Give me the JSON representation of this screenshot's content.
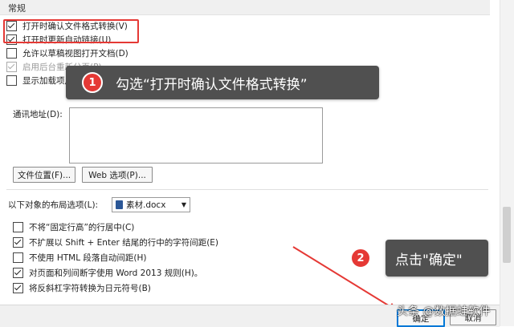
{
  "section": {
    "title": "常规"
  },
  "general_options": [
    {
      "label": "打开时确认文件格式转换(V)",
      "checked": true,
      "disabled": false
    },
    {
      "label": "打开时更新自动链接(U)",
      "checked": true,
      "disabled": false
    },
    {
      "label": "允许以草稿视图打开文档(D)",
      "checked": false,
      "disabled": false
    },
    {
      "label": "启用后台重新分页(P)",
      "checked": true,
      "disabled": true
    },
    {
      "label": "显示加载项用户界面错误(U)",
      "checked": false,
      "disabled": false
    }
  ],
  "tooltip1": {
    "number": "1",
    "text": "勾选“打开时确认文件格式转换”"
  },
  "address": {
    "label": "通讯地址(D):",
    "value": ""
  },
  "buttons": {
    "file_location": "文件位置(F)...",
    "web_options": "Web 选项(P)..."
  },
  "layout": {
    "label": "以下对象的布局选项(L):",
    "document": "素材.docx"
  },
  "layout_options": [
    {
      "label": "不将“固定行高”的行居中(C)",
      "checked": false
    },
    {
      "label": "不扩展以 Shift + Enter 结尾的行中的字符间距(E)",
      "checked": true
    },
    {
      "label": "不使用 HTML 段落自动间距(H)",
      "checked": false
    },
    {
      "label": "对页面和列间断字使用 Word 2013 规则(H)。",
      "checked": true
    },
    {
      "label": "将反斜杠字符转换为日元符号(B)",
      "checked": true
    }
  ],
  "tooltip2": {
    "number": "2",
    "text": "点击\"确定\""
  },
  "dialog_buttons": {
    "ok": "确定",
    "cancel": "取消"
  },
  "watermark": "头条 @数据蛙软件",
  "colors": {
    "accent_red": "#e53935",
    "tooltip_bg": "#505050"
  }
}
